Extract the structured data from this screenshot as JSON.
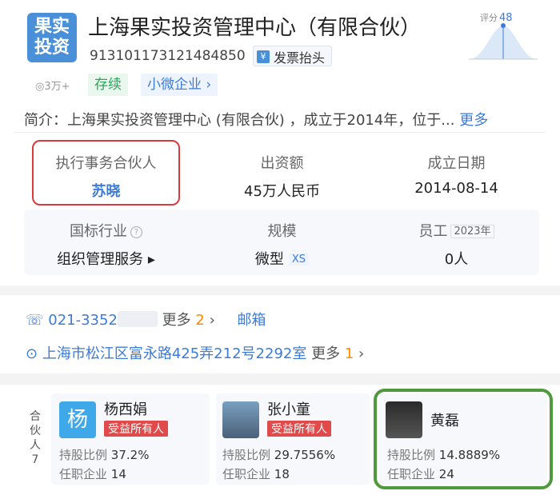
{
  "company": {
    "logo_text": "果实\n投资",
    "name": "上海果实投资管理中心（有限合伙）",
    "credit_code": "913101173121484850",
    "invoice_label": "发票抬头",
    "invoice_icon": "yen-icon",
    "score_label": "评分",
    "score_value": "48",
    "views": "3万+",
    "status_tag": "存续",
    "size_tag": "小微企业",
    "intro_label": "简介：",
    "intro_text": "上海果实投资管理中心 (有限合伙) ，成立于2014年，位于...",
    "intro_more": "更多"
  },
  "info": {
    "partner_label": "执行事务合伙人",
    "partner_value": "苏晓",
    "capital_label": "出资额",
    "capital_value": "45万人民币",
    "date_label": "成立日期",
    "date_value": "2014-08-14",
    "industry_label": "国标行业",
    "industry_value": "组织管理服务",
    "scale_label": "规模",
    "scale_value": "微型",
    "scale_tag": "XS",
    "staff_label": "员工",
    "staff_year": "2023年",
    "staff_value": "0人"
  },
  "contact": {
    "phone": "021-3352",
    "phone_more": "更多",
    "phone_more_count": "2",
    "email_label": "邮箱",
    "address": "上海市松江区富永路425弄212号2292室",
    "address_more": "更多",
    "address_more_count": "1"
  },
  "partners": {
    "side_label": "合伙人",
    "count": "7",
    "share_label": "持股比例",
    "company_label": "任职企业",
    "items": [
      {
        "avatar_text": "杨",
        "name": "杨西娟",
        "badge": "受益所有人",
        "share": "37.2%",
        "companies": "14"
      },
      {
        "avatar_text": "",
        "name": "张小童",
        "badge": "受益所有人",
        "share": "29.7556%",
        "companies": "18"
      },
      {
        "avatar_text": "",
        "name": "黄磊",
        "badge": "",
        "share": "14.8889%",
        "companies": "24"
      }
    ]
  },
  "colors": {
    "accent": "#3d7bd8",
    "highlight_red": "#d93a3a",
    "highlight_green": "#4e9a3c"
  }
}
